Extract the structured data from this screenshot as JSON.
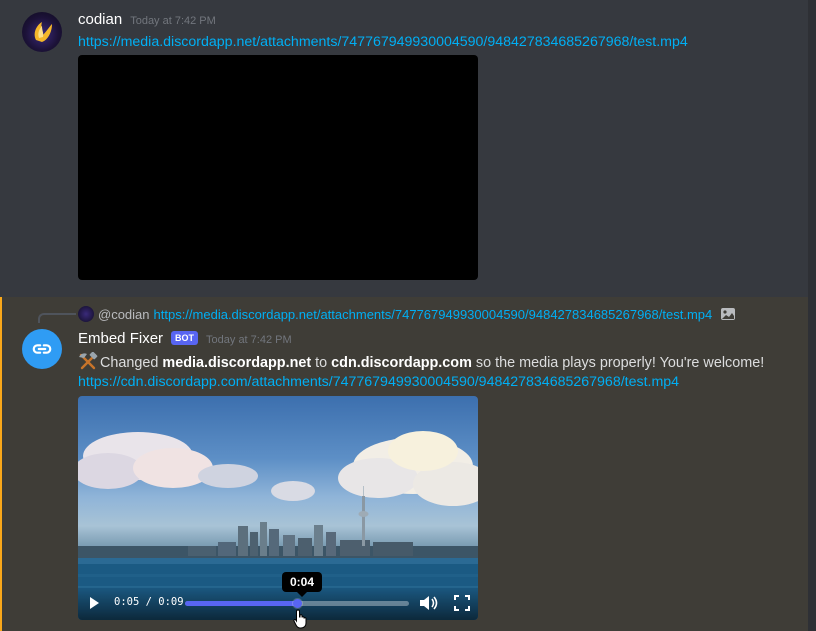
{
  "messages": [
    {
      "author": "codian",
      "timestamp": "Today at 7:42 PM",
      "link": "https://media.discordapp.net/attachments/747767949930004590/948427834685267968/test.mp4"
    },
    {
      "reply": {
        "author": "@codian",
        "link": "https://media.discordapp.net/attachments/747767949930004590/948427834685267968/test.mp4"
      },
      "author": "Embed Fixer",
      "bot_tag": "BOT",
      "timestamp": "Today at 7:42 PM",
      "text_prefix": "Changed ",
      "old_domain": "media.discordapp.net",
      "text_mid": " to ",
      "new_domain": "cdn.discordapp.com",
      "text_suffix": " so the media plays properly! You're welcome!",
      "emoji": "hammer-and-pick-icon",
      "link": "https://cdn.discordapp.com/attachments/747767949930004590/948427834685267968/test.mp4",
      "video": {
        "current_time": "0:05",
        "separator": "/",
        "duration": "0:09",
        "progress": 0.5,
        "hover_time": "0:04"
      }
    }
  ],
  "colors": {
    "background": "#36393f",
    "highlight": "#3f3d37",
    "mention_bar": "#faa81a",
    "link": "#00aff4",
    "accent": "#5865f2",
    "bot_avatar": "#2f9cf4"
  }
}
